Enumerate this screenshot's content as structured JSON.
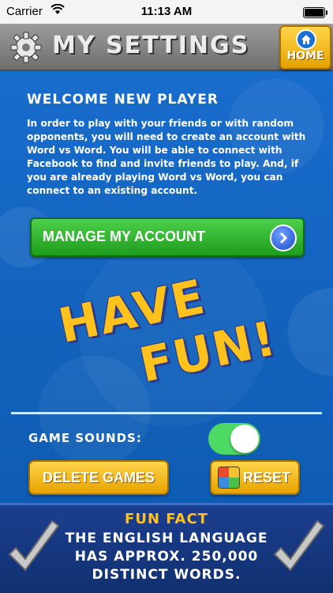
{
  "status_bar": {
    "carrier": "Carrier",
    "time": "11:13 AM"
  },
  "header": {
    "title": "MY SETTINGS",
    "home_label": "HOME"
  },
  "welcome": {
    "title": "WELCOME NEW PLAYER",
    "body": "In order to play with your friends or with random opponents, you will need to create an account with Word vs Word.  You will be able to connect with Facebook to find and invite friends to play. And, if you are already playing Word vs Word, you can connect to an existing account."
  },
  "manage_button": {
    "label": "MANAGE MY ACCOUNT"
  },
  "promo": {
    "line1": "HAVE",
    "line2": "FUN!"
  },
  "settings": {
    "game_sounds_label": "GAME SOUNDS:",
    "game_sounds_on": true,
    "delete_label": "DELETE GAMES",
    "reset_label": "RESET"
  },
  "fun_fact": {
    "title": "FUN FACT",
    "line1": "THE ENGLISH LANGUAGE",
    "line2": "HAS APPROX. 250,000",
    "line3": "DISTINCT WORDS."
  },
  "colors": {
    "accent": "#ffc21c",
    "green_button": "#2bb02a",
    "toggle_on": "#4cd964"
  }
}
